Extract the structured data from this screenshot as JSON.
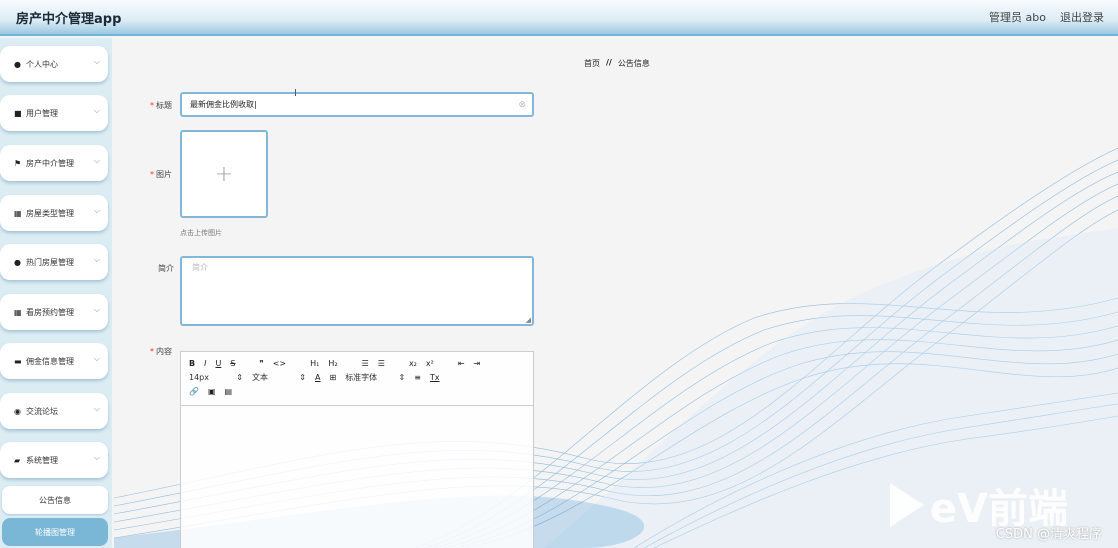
{
  "header": {
    "app_title": "房产中介管理app",
    "user_label": "管理员 abo",
    "logout_label": "退出登录"
  },
  "sidebar": {
    "items": [
      {
        "label": "个人中心",
        "icon": "user-icon"
      },
      {
        "label": "用户管理",
        "icon": "document-icon"
      },
      {
        "label": "房产中介管理",
        "icon": "flag-icon"
      },
      {
        "label": "房屋类型管理",
        "icon": "grid-icon"
      },
      {
        "label": "热门房屋管理",
        "icon": "user-icon"
      },
      {
        "label": "看房预约管理",
        "icon": "grid-icon"
      },
      {
        "label": "佣金信息管理",
        "icon": "monitor-icon"
      },
      {
        "label": "交流论坛",
        "icon": "location-icon"
      },
      {
        "label": "系统管理",
        "icon": "ticket-icon"
      }
    ],
    "sub_items": [
      {
        "label": "公告信息",
        "state": "normal"
      },
      {
        "label": "轮播图管理",
        "state": "active"
      }
    ]
  },
  "breadcrumb": {
    "home": "首页",
    "separator": "//",
    "current": "公告信息"
  },
  "form": {
    "title_label": "标题",
    "title_value": "最新佣金比例收取",
    "image_label": "图片",
    "upload_tip": "点击上传图片",
    "intro_label": "简介",
    "intro_placeholder": "简介",
    "content_label": "内容"
  },
  "editor": {
    "row1": [
      "B",
      "I",
      "U",
      "S",
      "❞",
      "<>",
      "H₁",
      "H₂",
      "☰",
      "☰",
      "x₂",
      "x²",
      "⇤",
      "⇥"
    ],
    "font_size": "14px",
    "header_select": "文本",
    "font_family": "标准字体",
    "row2_extra": [
      "A",
      "⊞",
      "≡",
      "Tx"
    ],
    "row3": [
      "🔗",
      "▣",
      "▤"
    ]
  },
  "watermark": {
    "text": "CSDN @清爽程序",
    "logo_text": "eV前端"
  },
  "colors": {
    "accent": "#7fb8d8",
    "active_sub": "#7ab7d6",
    "required": "#e33333",
    "wave": "#3d8fd4"
  }
}
